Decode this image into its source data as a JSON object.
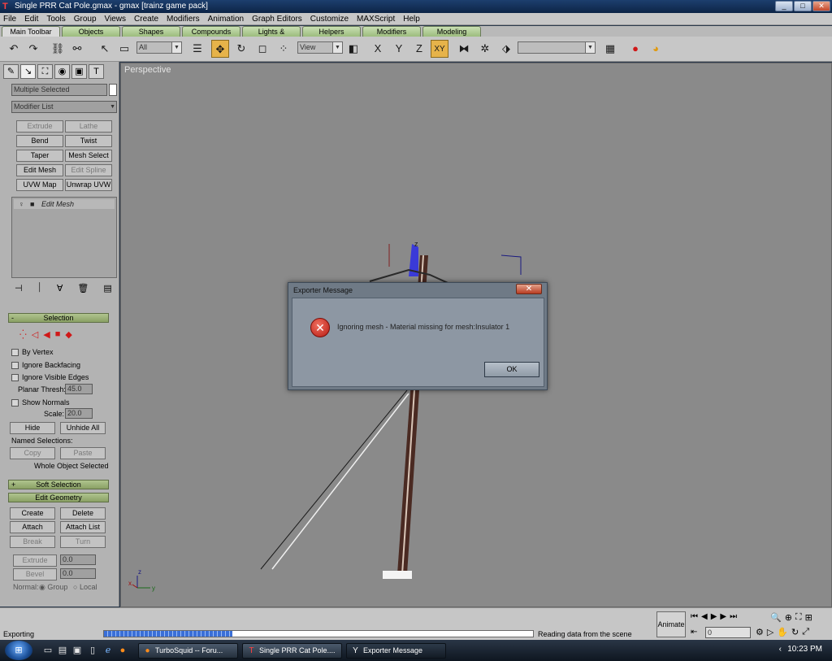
{
  "window": {
    "title": "Single PRR Cat Pole.gmax  - gmax   [trainz game pack]",
    "minimize": "_",
    "maximize": "□",
    "close": "✕"
  },
  "menu": [
    "File",
    "Edit",
    "Tools",
    "Group",
    "Views",
    "Create",
    "Modifiers",
    "Animation",
    "Graph Editors",
    "Customize",
    "MAXScript",
    "Help"
  ],
  "tabs": [
    "Main Toolbar",
    "Objects",
    "Shapes",
    "Compounds",
    "Lights & Cameras",
    "Helpers",
    "Modifiers",
    "Modeling"
  ],
  "toolbar": {
    "selection_filter": "All",
    "reference_coord": "View",
    "named_selection": "",
    "axis_x": "X",
    "axis_y": "Y",
    "axis_z": "Z",
    "axis_xy": "XY"
  },
  "command_panel": {
    "object_name": "Multiple Selected",
    "modifier_list": "Modifier List",
    "modifier_buttons": [
      {
        "label": "Extrude",
        "disabled": true
      },
      {
        "label": "Lathe",
        "disabled": true
      },
      {
        "label": "Bend",
        "disabled": false
      },
      {
        "label": "Twist",
        "disabled": false
      },
      {
        "label": "Taper",
        "disabled": false
      },
      {
        "label": "Mesh Select",
        "disabled": false
      },
      {
        "label": "Edit Mesh",
        "disabled": false
      },
      {
        "label": "Edit Spline",
        "disabled": true
      },
      {
        "label": "UVW Map",
        "disabled": false
      },
      {
        "label": "Unwrap UVW",
        "disabled": false
      }
    ],
    "stack_item": "Edit Mesh",
    "selection_rollout": "Selection",
    "by_vertex": "By Vertex",
    "ignore_backfacing": "Ignore Backfacing",
    "ignore_visible_edges": "Ignore Visible Edges",
    "planar_thresh_label": "Planar Thresh:",
    "planar_thresh_value": "45.0",
    "show_normals": "Show Normals",
    "scale_label": "Scale:",
    "scale_value": "20.0",
    "hide": "Hide",
    "unhide_all": "Unhide All",
    "named_selections": "Named Selections:",
    "copy": "Copy",
    "paste": "Paste",
    "whole_object": "Whole Object Selected",
    "soft_selection": "Soft Selection",
    "edit_geometry": "Edit Geometry",
    "create": "Create",
    "delete": "Delete",
    "attach": "Attach",
    "attach_list": "Attach List",
    "break": "Break",
    "turn": "Turn",
    "extrude": "Extrude",
    "extrude_value": "0.0",
    "bevel": "Bevel",
    "bevel_value": "0.0",
    "normal_label": "Normal:",
    "group": "Group",
    "local": "Local",
    "plus": "+",
    "minus": "-"
  },
  "viewport": {
    "label": "Perspective",
    "gizmo_z": "z",
    "axis_z": "z",
    "axis_y": "y",
    "axis_x": "x"
  },
  "dialog": {
    "title": "Exporter Message",
    "message": "Ignoring mesh - Material missing for mesh:Insulator 1",
    "ok": "OK",
    "close": "✕"
  },
  "status": {
    "left_text": "Exporting",
    "progress": 0.3,
    "right_text": "Reading data from the scene",
    "animate": "Animate",
    "frame_value": "0"
  },
  "taskbar": {
    "tasks": [
      "TurboSquid -- Foru...",
      "Single PRR Cat Pole....",
      "Exporter Message"
    ],
    "clock": "10:23 PM"
  },
  "colors": {
    "accent_orange": "#e6b34a",
    "rollout_green": "#9cbc7e",
    "error_red": "#c62a1e"
  }
}
